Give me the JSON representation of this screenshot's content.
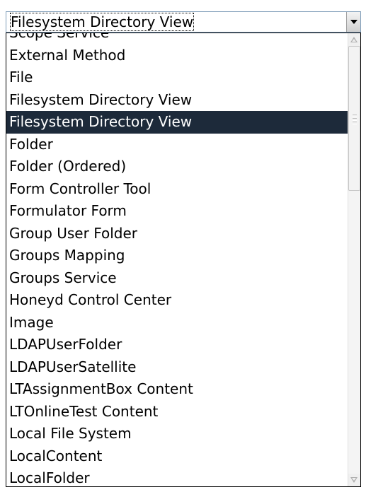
{
  "select": {
    "value": "Filesystem Directory View"
  },
  "list": {
    "items": [
      {
        "label": "Scope Service"
      },
      {
        "label": "External Method"
      },
      {
        "label": "File"
      },
      {
        "label": "Filesystem Directory View"
      },
      {
        "label": "Filesystem Directory View",
        "selected": true
      },
      {
        "label": "Folder"
      },
      {
        "label": "Folder (Ordered)"
      },
      {
        "label": "Form Controller Tool"
      },
      {
        "label": "Formulator Form"
      },
      {
        "label": "Group User Folder"
      },
      {
        "label": "Groups Mapping"
      },
      {
        "label": "Groups Service"
      },
      {
        "label": "Honeyd Control Center"
      },
      {
        "label": "Image"
      },
      {
        "label": "LDAPUserFolder"
      },
      {
        "label": "LDAPUserSatellite"
      },
      {
        "label": "LTAssignmentBox Content"
      },
      {
        "label": "LTOnlineTest Content"
      },
      {
        "label": "Local File System"
      },
      {
        "label": "LocalContent"
      },
      {
        "label": "LocalFolder"
      }
    ]
  },
  "icons": {
    "dropdown_arrow": "chevron-down-icon",
    "scroll_up": "scroll-up-arrow-icon",
    "scroll_down": "scroll-down-arrow-icon"
  }
}
